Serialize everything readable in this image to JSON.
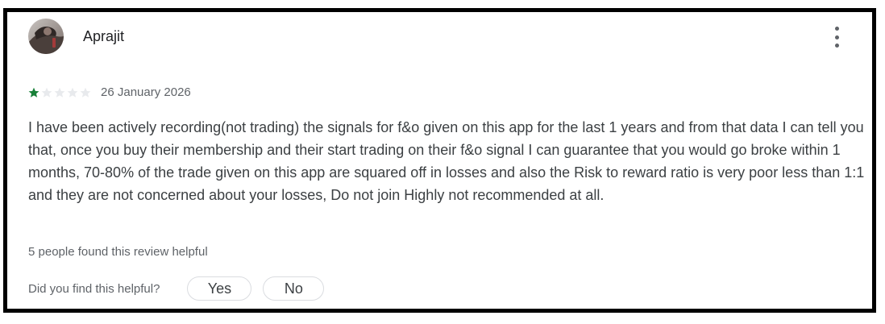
{
  "review": {
    "author": "Aprajit",
    "rating": 1,
    "max_rating": 5,
    "date": "26 January 2026",
    "text": "I have been actively recording(not trading) the signals for f&o given on this app for the last 1 years and from that data I can tell you that, once you buy their membership and their start trading on their f&o signal I can guarantee that you would go broke within 1 months, 70-80% of the trade given on this app are squared off in losses and also the Risk to reward ratio is very poor less than 1:1 and they are not concerned about your losses, Do not join Highly not recommended at all.",
    "helpful_count_text": "5 people found this review helpful"
  },
  "feedback": {
    "question": "Did you find this helpful?",
    "yes_label": "Yes",
    "no_label": "No"
  },
  "colors": {
    "star_filled": "#188038",
    "star_empty": "#e8eaed",
    "frame_border": "#000000"
  },
  "icons": {
    "menu": "more-vertical-icon",
    "rating": "star-icon"
  }
}
